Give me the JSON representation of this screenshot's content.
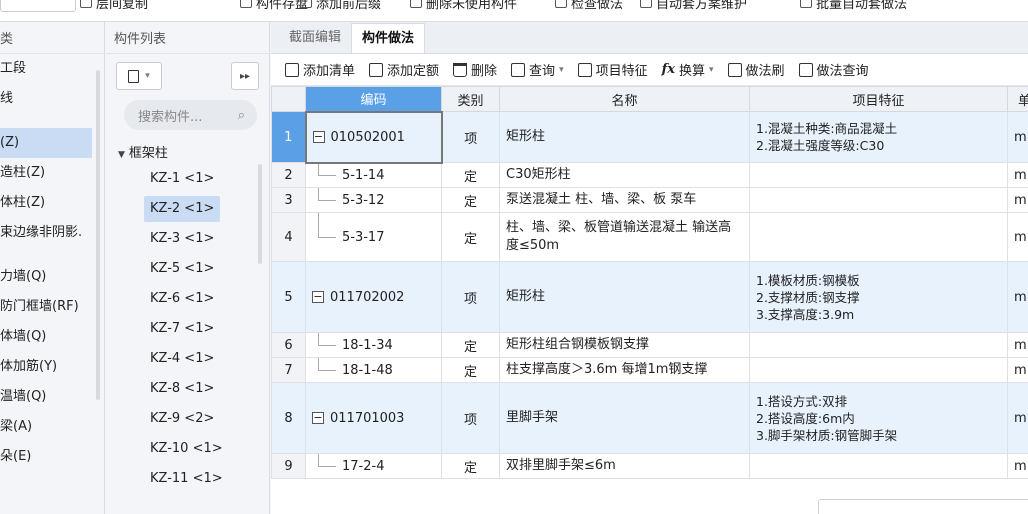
{
  "toolbar_top": {
    "items": [
      {
        "label": "层间复制",
        "icon": "copy-icon"
      },
      {
        "label": "构件存盘",
        "icon": "save-icon"
      },
      {
        "label": "添加前后缀",
        "icon": "prefix-icon"
      },
      {
        "label": "删除未使用构件",
        "icon": "delete-unused-icon"
      },
      {
        "label": "检查做法",
        "icon": "check-icon"
      },
      {
        "label": "自动套方案维护",
        "icon": "maintain-icon"
      },
      {
        "label": "批量自动套做法",
        "icon": "batch-icon"
      }
    ]
  },
  "nav_tree": {
    "header": "类",
    "items": [
      "工段",
      "线",
      "",
      "(Z)",
      "造柱(Z)",
      "体柱(Z)",
      "束边缘非阴影.",
      "",
      "力墙(Q)",
      "防门框墙(RF)",
      "体墙(Q)",
      "体加筋(Y)",
      "温墙(Q)",
      "梁(A)",
      "朵(E)"
    ],
    "selected_index": 3
  },
  "component_list": {
    "header": "构件列表",
    "search_placeholder": "搜索构件...",
    "group": "框架柱",
    "items": [
      "KZ-1 <1>",
      "KZ-2 <1>",
      "KZ-3 <1>",
      "KZ-5 <1>",
      "KZ-6 <1>",
      "KZ-7 <1>",
      "KZ-4 <1>",
      "KZ-8 <1>",
      "KZ-9 <2>",
      "KZ-10 <1>",
      "KZ-11 <1>"
    ],
    "selected_index": 1
  },
  "tabs": [
    {
      "label": "截面编辑",
      "active": false
    },
    {
      "label": "构件做法",
      "active": true
    }
  ],
  "actions": [
    {
      "label": "添加清单",
      "icon": "add-list-icon",
      "dropdown": false
    },
    {
      "label": "添加定额",
      "icon": "add-quota-icon",
      "dropdown": false
    },
    {
      "label": "删除",
      "icon": "trash-icon",
      "dropdown": false
    },
    {
      "label": "查询",
      "icon": "query-icon",
      "dropdown": true
    },
    {
      "label": "项目特征",
      "icon": "feature-icon",
      "dropdown": false
    },
    {
      "label": "换算",
      "icon": "fx-icon",
      "dropdown": true
    },
    {
      "label": "做法刷",
      "icon": "brush-icon",
      "dropdown": false
    },
    {
      "label": "做法查询",
      "icon": "method-query-icon",
      "dropdown": false
    }
  ],
  "grid": {
    "columns": [
      "编码",
      "类别",
      "名称",
      "项目特征",
      "单"
    ],
    "rows": [
      {
        "no": "1",
        "code": "010502001",
        "type": "项",
        "name": "矩形柱",
        "features": [
          "1.混凝土种类:商品混凝土",
          "2.混凝土强度等级:C30"
        ],
        "unit": "m",
        "level": "item"
      },
      {
        "no": "2",
        "code": "5-1-14",
        "type": "定",
        "name": "C30矩形柱",
        "features": [],
        "unit": "m",
        "level": "sub"
      },
      {
        "no": "3",
        "code": "5-3-12",
        "type": "定",
        "name": "泵送混凝土 柱、墙、梁、板 泵车",
        "features": [],
        "unit": "m",
        "level": "sub"
      },
      {
        "no": "4",
        "code": "5-3-17",
        "type": "定",
        "name": "柱、墙、梁、板管道输送混凝土 输送高度≤50m",
        "features": [],
        "unit": "m",
        "level": "sub"
      },
      {
        "no": "5",
        "code": "011702002",
        "type": "项",
        "name": "矩形柱",
        "features": [
          "1.模板材质:钢模板",
          "2.支撑材质:钢支撑",
          "3.支撑高度:3.9m"
        ],
        "unit": "m",
        "level": "item"
      },
      {
        "no": "6",
        "code": "18-1-34",
        "type": "定",
        "name": "矩形柱组合钢模板钢支撑",
        "features": [],
        "unit": "m",
        "level": "sub"
      },
      {
        "no": "7",
        "code": "18-1-48",
        "type": "定",
        "name": "柱支撑高度＞3.6m 每增1m钢支撑",
        "features": [],
        "unit": "m",
        "level": "sub"
      },
      {
        "no": "8",
        "code": "011701003",
        "type": "项",
        "name": "里脚手架",
        "features": [
          "1.搭设方式:双排",
          "2.搭设高度:6m内",
          "3.脚手架材质:钢管脚手架"
        ],
        "unit": "m",
        "level": "item"
      },
      {
        "no": "9",
        "code": "17-2-4",
        "type": "定",
        "name": "双排里脚手架≤6m",
        "features": [],
        "unit": "m",
        "level": "sub"
      }
    ]
  },
  "colors": {
    "accent": "#5aa0e6",
    "item_row": "#e8f2fc",
    "selected": "#c9dcf3"
  }
}
